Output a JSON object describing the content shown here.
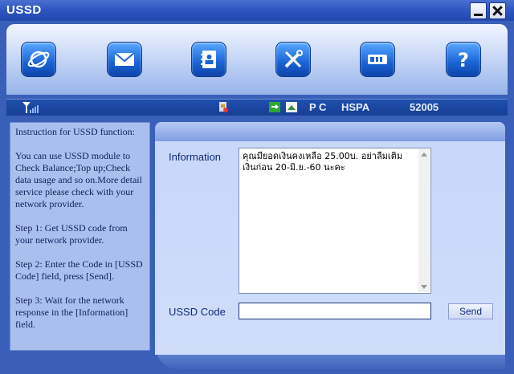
{
  "window": {
    "title": "USSD"
  },
  "toolbar": {
    "icons": [
      "internet-icon",
      "sms-icon",
      "contacts-icon",
      "settings-icon",
      "device-icon",
      "help-icon"
    ]
  },
  "status": {
    "connection_label": "P C",
    "network_type": "HSPA",
    "operator_code": "52005"
  },
  "instructions": {
    "heading": "Instruction for USSD function:",
    "intro": "You can use USSD module to Check Balance;Top up;Check data usage and so on.More detail service please check with your network provider.",
    "step1": "Step 1: Get USSD code from your network provider.",
    "step2": "Step 2: Enter the Code in [USSD Code] field, press [Send].",
    "step3": "Step 3: Wait for the network response in the [Information] field."
  },
  "form": {
    "information_label": "Information",
    "information_text": "คุณมียอดเงินคงเหลือ 25.00บ. อย่าลืมเติมเงินก่อน 20-มิ.ย.-60 นะคะ",
    "ussd_label": "USSD Code",
    "ussd_value": "",
    "send_label": "Send"
  },
  "colors": {
    "accent": "#2d55c0",
    "panel": "#a9bfee"
  }
}
